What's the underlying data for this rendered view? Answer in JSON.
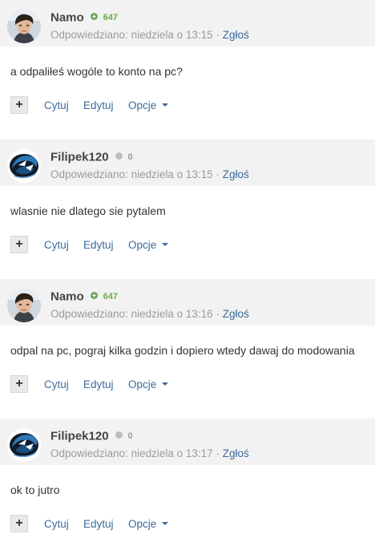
{
  "posts": [
    {
      "author": "Namo",
      "reputation": "647",
      "rep_type": "positive",
      "avatar": "avatar-boy",
      "answered_label": "Odpowiedziano:",
      "time": "niedziela o 13:15",
      "separator": "·",
      "report": "Zgłoś",
      "body": "a odpaliłeś wogóle to konto na pc?",
      "controls": {
        "plus": "+",
        "quote": "Cytuj",
        "edit": "Edytuj",
        "options": "Opcje"
      }
    },
    {
      "author": "Filipek120",
      "reputation": "0",
      "rep_type": "neutral",
      "avatar": "avatar-logo",
      "answered_label": "Odpowiedziano:",
      "time": "niedziela o 13:15",
      "separator": "·",
      "report": "Zgłoś",
      "body": "wlasnie nie dlatego sie pytalem",
      "controls": {
        "plus": "+",
        "quote": "Cytuj",
        "edit": "Edytuj",
        "options": "Opcje"
      }
    },
    {
      "author": "Namo",
      "reputation": "647",
      "rep_type": "positive",
      "avatar": "avatar-boy",
      "answered_label": "Odpowiedziano:",
      "time": "niedziela o 13:16",
      "separator": "·",
      "report": "Zgłoś",
      "body": "odpal na pc, pograj kilka godzin i dopiero wtedy dawaj do modowania",
      "controls": {
        "plus": "+",
        "quote": "Cytuj",
        "edit": "Edytuj",
        "options": "Opcje"
      }
    },
    {
      "author": "Filipek120",
      "reputation": "0",
      "rep_type": "neutral",
      "avatar": "avatar-logo",
      "answered_label": "Odpowiedziano:",
      "time": "niedziela o 13:17",
      "separator": "·",
      "report": "Zgłoś",
      "body": "ok to jutro",
      "controls": {
        "plus": "+",
        "quote": "Cytuj",
        "edit": "Edytuj",
        "options": "Opcje"
      }
    }
  ],
  "colors": {
    "header_bg": "#f2f2f2",
    "link": "#3d6a9c",
    "meta": "#9b9b9b",
    "rep_positive": "#6aa84f",
    "rep_neutral": "#bdbdbd"
  }
}
